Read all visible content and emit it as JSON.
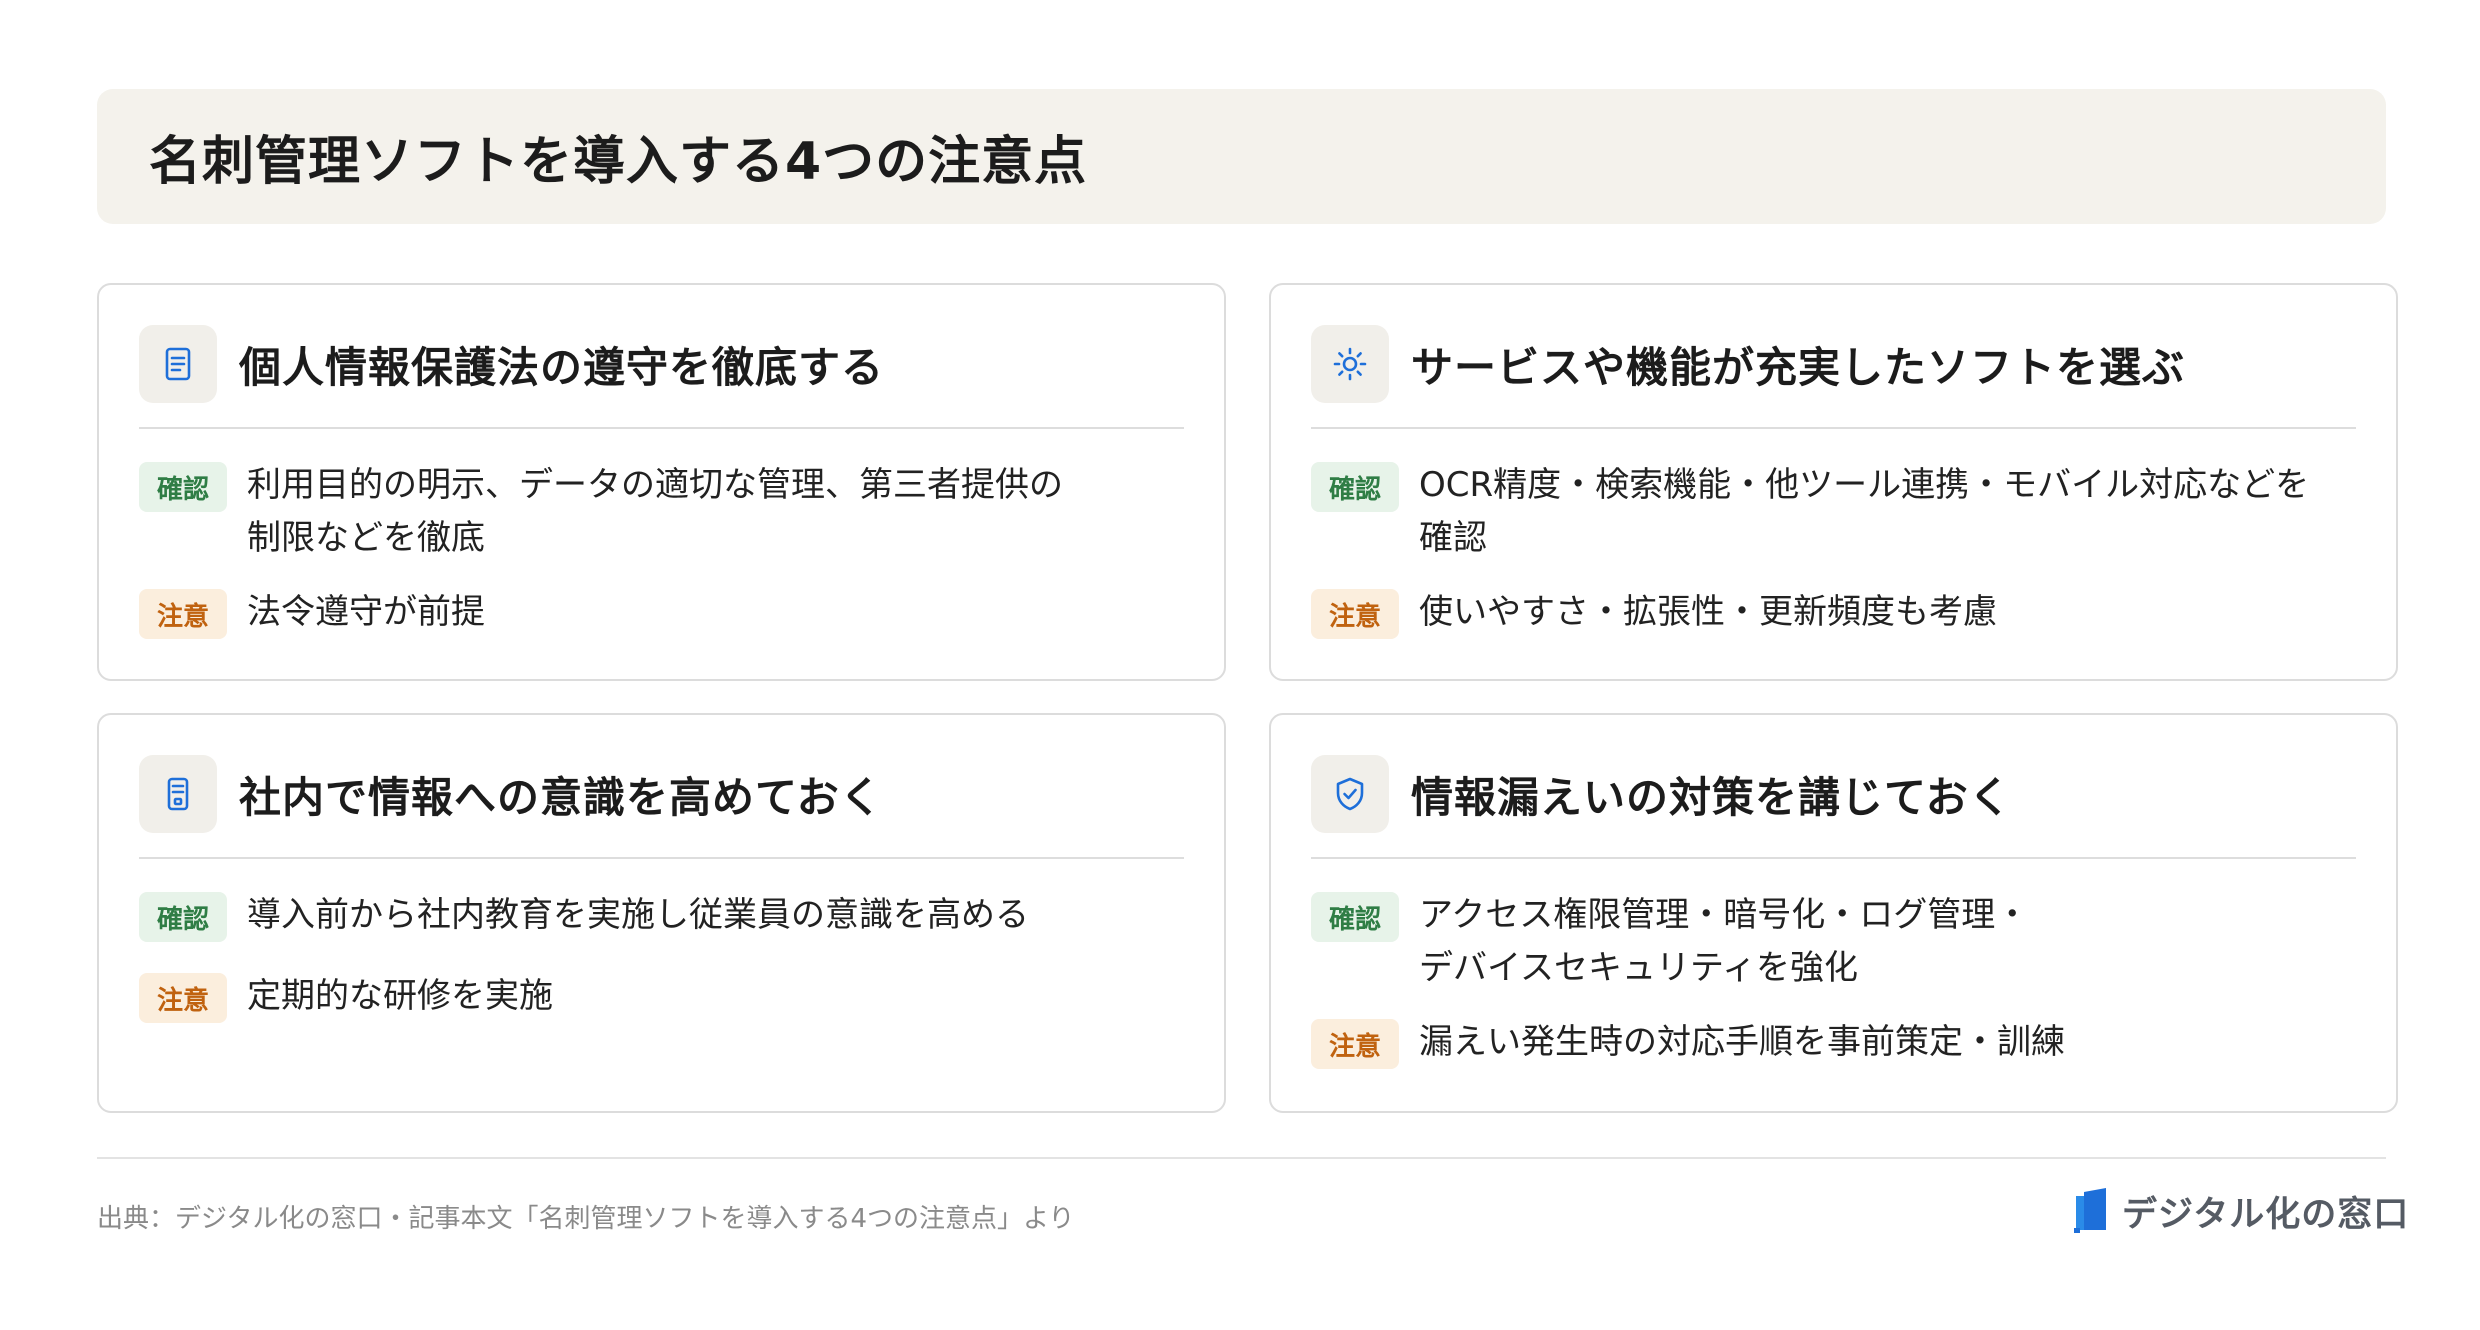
{
  "title": "名刺管理ソフトを導入する4つの注意点",
  "labels": {
    "confirm": "確認",
    "caution": "注意"
  },
  "cards": [
    {
      "title": "個人情報保護法の遵守を徹底する",
      "icon": "document-icon",
      "confirm": "利用目的の明示、データの適切な管理、第三者提供の\n制限などを徹底",
      "caution": "法令遵守が前提"
    },
    {
      "title": "サービスや機能が充実したソフトを選ぶ",
      "icon": "sun-icon",
      "confirm": "OCR精度・検索機能・他ツール連携・モバイル対応などを\n確認",
      "caution": "使いやすさ・拡張性・更新頻度も考慮"
    },
    {
      "title": "社内で情報への意識を高めておく",
      "icon": "badge-icon",
      "confirm": "導入前から社内教育を実施し従業員の意識を高める",
      "caution": "定期的な研修を実施"
    },
    {
      "title": "情報漏えいの対策を講じておく",
      "icon": "shield-check-icon",
      "confirm": "アクセス権限管理・暗号化・ログ管理・\nデバイスセキュリティを強化",
      "caution": "漏えい発生時の対応手順を事前策定・訓練"
    }
  ],
  "footer": {
    "source": "出典：デジタル化の窓口・記事本文「名刺管理ソフトを導入する4つの注意点」より",
    "logo_text": "デジタル化の窓口"
  },
  "colors": {
    "accent_blue": "#1e6fd9",
    "confirm_green": "#2f7d45",
    "caution_orange": "#c0620f",
    "title_bg": "#f4f2ec"
  }
}
